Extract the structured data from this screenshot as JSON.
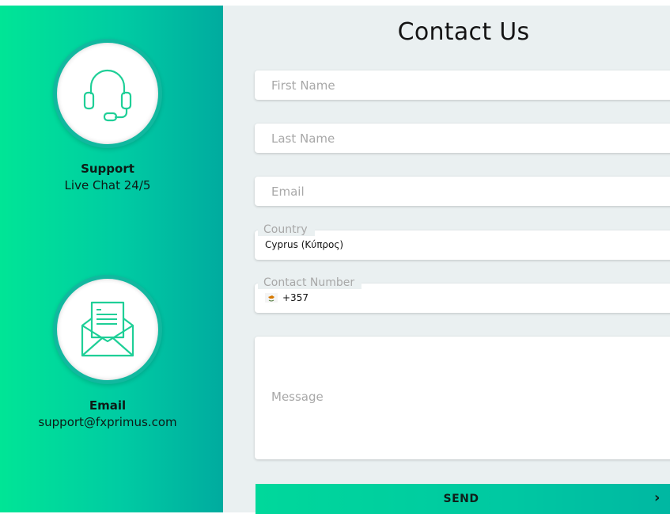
{
  "colors": {
    "accent": "#00d89b",
    "icon_stroke": "#1fcf97",
    "panel_bg": "#eaf0f1"
  },
  "sidebar": {
    "support": {
      "icon": "headset-icon",
      "title": "Support",
      "subtitle": "Live Chat 24/5"
    },
    "email": {
      "icon": "envelope-icon",
      "title": "Email",
      "subtitle": "support@fxprimus.com"
    }
  },
  "form": {
    "title": "Contact Us",
    "first_name": {
      "placeholder": "First Name",
      "value": ""
    },
    "last_name": {
      "placeholder": "Last Name",
      "value": ""
    },
    "email": {
      "placeholder": "Email",
      "value": ""
    },
    "country": {
      "label": "Country",
      "value": "Cyprus (Κύπρος)"
    },
    "contact_number": {
      "label": "Contact Number",
      "flag_icon": "cyprus-flag-icon",
      "dial_code": "+357"
    },
    "message": {
      "placeholder": "Message",
      "value": ""
    },
    "send_label": "SEND",
    "send_icon": "chevron-right-icon"
  }
}
